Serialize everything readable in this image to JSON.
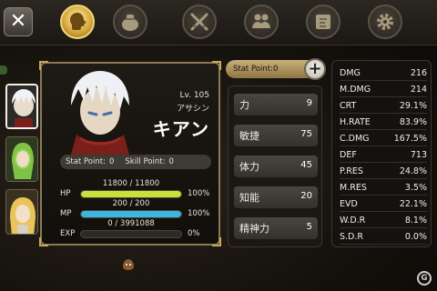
{
  "topbar": {
    "close_symbol": "✕",
    "tabs": [
      {
        "icon": "head-profile-icon",
        "active": true
      },
      {
        "icon": "item-bag-icon",
        "active": false
      },
      {
        "icon": "crossed-swords-icon",
        "active": false
      },
      {
        "icon": "party-group-icon",
        "active": false
      },
      {
        "icon": "quest-scroll-icon",
        "active": false
      },
      {
        "icon": "gear-icon",
        "active": false
      }
    ]
  },
  "character": {
    "level": "Lv. 105",
    "job": "アサシン",
    "name": "キアン",
    "stat_point_label": "Stat Point:",
    "stat_point_value": "0",
    "skill_point_label": "Skill Point:",
    "skill_point_value": "0",
    "gauges": [
      {
        "label": "HP",
        "value_text": "11800 / 11800",
        "percent_text": "100%",
        "fill": 1.0,
        "color": "#c7e03a"
      },
      {
        "label": "MP",
        "value_text": "200 / 200",
        "percent_text": "100%",
        "fill": 1.0,
        "color": "#3ab6e0"
      },
      {
        "label": "EXP",
        "value_text": "0 / 3991088",
        "percent_text": "0%",
        "fill": 0.0,
        "color": "#e0c03a"
      }
    ]
  },
  "attributes": {
    "stat_point_label": "Stat Point:",
    "stat_point_value": "0",
    "plus_symbol": "+",
    "items": [
      {
        "name": "力",
        "value": "9"
      },
      {
        "name": "敏捷",
        "value": "75"
      },
      {
        "name": "体力",
        "value": "45"
      },
      {
        "name": "知能",
        "value": "20"
      },
      {
        "name": "精神力",
        "value": "5"
      }
    ]
  },
  "stats": [
    {
      "name": "DMG",
      "value": "216"
    },
    {
      "name": "M.DMG",
      "value": "214"
    },
    {
      "name": "CRT",
      "value": "29.1%"
    },
    {
      "name": "H.RATE",
      "value": "83.9%"
    },
    {
      "name": "C.DMG",
      "value": "167.5%"
    },
    {
      "name": "DEF",
      "value": "713"
    },
    {
      "name": "P.RES",
      "value": "24.8%"
    },
    {
      "name": "M.RES",
      "value": "3.5%"
    },
    {
      "name": "EVD",
      "value": "22.1%"
    },
    {
      "name": "W.D.R",
      "value": "8.1%"
    },
    {
      "name": "S.D.R",
      "value": "0.0%"
    }
  ],
  "colors": {
    "accent_gold": "#c9a85a",
    "hp": "#c7e03a",
    "mp": "#3ab6e0"
  }
}
